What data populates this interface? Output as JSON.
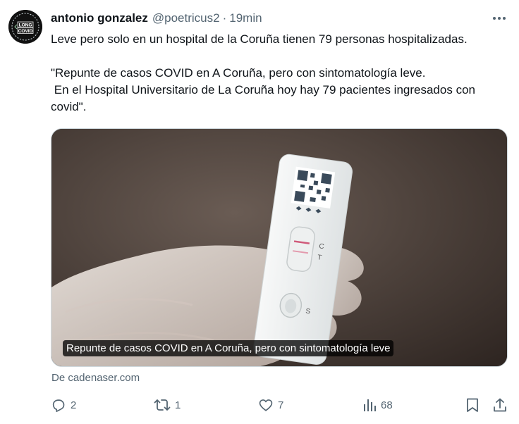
{
  "tweet": {
    "author_name": "antonio gonzalez",
    "handle": "@poetricus2",
    "separator": "·",
    "time": "19min",
    "avatar_text": [
      "LONG",
      "COVID"
    ],
    "text_line1": "Leve pero solo en un hospital de la Coruña tienen 79 personas hospitalizadas.",
    "text_quote": "\"Repunte de casos COVID en A Coruña, pero con sintomatología leve.\n En el Hospital Universitario de La Coruña hoy hay 79 pacientes ingresados con covid\".",
    "media_caption": "Repunte de casos COVID en A Coruña, pero con sintomatología leve",
    "test_labels": {
      "control": "C",
      "test": "T",
      "sample": "S"
    },
    "source": "De cadenaser.com"
  },
  "actions": {
    "replies": "2",
    "retweets": "1",
    "likes": "7",
    "views": "68"
  },
  "icons": {
    "more": "more-horizontal-icon",
    "reply": "reply-icon",
    "retweet": "retweet-icon",
    "like": "heart-icon",
    "views": "analytics-icon",
    "bookmark": "bookmark-icon",
    "share": "share-icon"
  },
  "colors": {
    "text": "#0f1419",
    "muted": "#536471",
    "border": "#cfd9de"
  }
}
